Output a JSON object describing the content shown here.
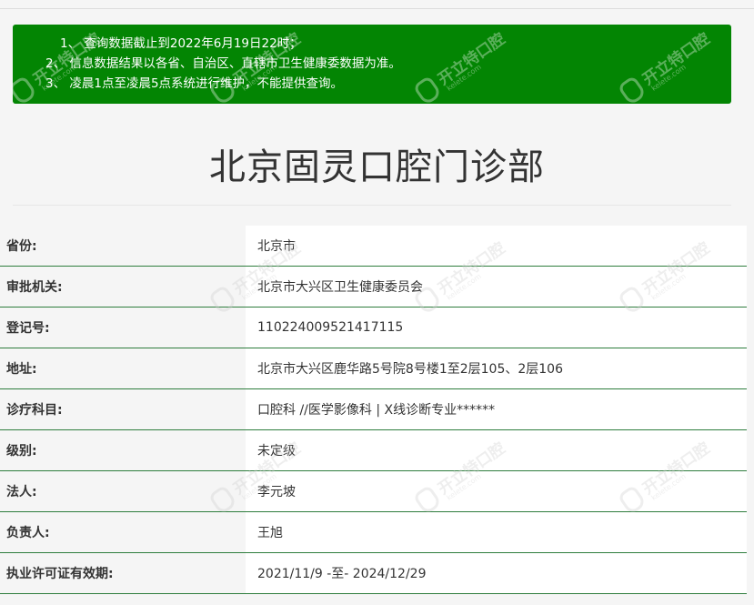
{
  "notice": {
    "lines": [
      "1、 查询数据截止到2022年6月19日22时；",
      "2、 信息数据结果以各省、自治区、直辖市卫生健康委数据为准。",
      "3、 凌晨1点至凌晨5点系统进行维护，不能提供查询。"
    ],
    "bg_color": "#038503"
  },
  "title": "北京固灵口腔门诊部",
  "rows": [
    {
      "label": "省份:",
      "value": "北京市"
    },
    {
      "label": "审批机关:",
      "value": "北京市大兴区卫生健康委员会"
    },
    {
      "label": "登记号:",
      "value": "110224009521417115"
    },
    {
      "label": "地址:",
      "value": "北京市大兴区鹿华路5号院8号楼1至2层105、2层106"
    },
    {
      "label": "诊疗科目:",
      "value": "口腔科 //医学影像科 | X线诊断专业******"
    },
    {
      "label": "级别:",
      "value": "未定级"
    },
    {
      "label": "法人:",
      "value": "李元坡"
    },
    {
      "label": "负责人:",
      "value": "王旭"
    },
    {
      "label": "执业许可证有效期:",
      "value": "2021/11/9 -至- 2024/12/29"
    }
  ],
  "watermark": {
    "text": "开立特口腔",
    "subtext": "kelete.com",
    "icon": "tooth-icon"
  }
}
